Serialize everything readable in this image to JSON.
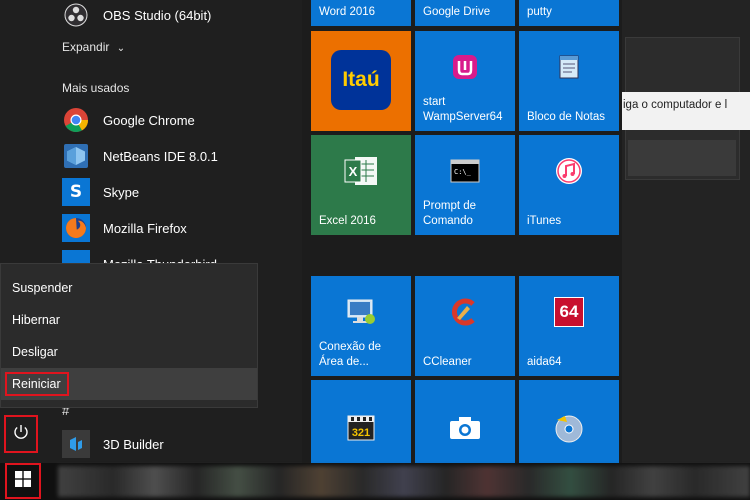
{
  "app_list": {
    "top_app": "OBS Studio (64bit)",
    "expand_label": "Expandir",
    "most_used_label": "Mais usados",
    "most_used": [
      "Google Chrome",
      "NetBeans IDE 8.0.1",
      "Skype",
      "Mozilla Firefox",
      "Mozilla Thunderbird"
    ],
    "hash_label": "#",
    "hash_apps": [
      "3D Builder"
    ]
  },
  "power_menu": {
    "items": [
      "Suspender",
      "Hibernar",
      "Desligar",
      "Reiniciar"
    ],
    "highlighted": "Reiniciar"
  },
  "tiles": {
    "top_row": [
      "Word 2016",
      "Google Drive",
      "putty"
    ],
    "row1": [
      {
        "label": "",
        "icon": "itau-logo",
        "icon_text": "Itaú",
        "color": "#ec7000"
      },
      {
        "label": "start WampServer64",
        "icon": "wamp-icon",
        "color": "#0a76d4"
      },
      {
        "label": "Bloco de Notas",
        "icon": "notepad-icon",
        "color": "#0a76d4"
      }
    ],
    "row2": [
      {
        "label": "Excel 2016",
        "icon": "excel-icon",
        "color": "#2d7a4a"
      },
      {
        "label": "Prompt de Comando",
        "icon": "cmd-icon",
        "color": "#0a76d4"
      },
      {
        "label": "iTunes",
        "icon": "itunes-icon",
        "color": "#0a76d4"
      }
    ],
    "row3": [
      {
        "label": "Conexão de Área de...",
        "icon": "remote-desktop-icon",
        "color": "#0a76d4"
      },
      {
        "label": "CCleaner",
        "icon": "ccleaner-icon",
        "color": "#0a76d4"
      },
      {
        "label": "aida64",
        "icon": "aida64-icon",
        "icon_text": "64",
        "color": "#0a76d4"
      }
    ],
    "row4": [
      {
        "label": "",
        "icon": "media-player-classic-icon",
        "color": "#0a76d4"
      },
      {
        "label": "",
        "icon": "camera-icon",
        "color": "#0a76d4"
      },
      {
        "label": "",
        "icon": "dvd-icon",
        "color": "#0a76d4"
      }
    ]
  },
  "background_window": {
    "tooltip_text": "iga o computador e l"
  },
  "icons": {
    "power": "power-icon",
    "start": "windows-logo-icon"
  },
  "colors": {
    "tile_blue": "#0a76d4",
    "highlight_red": "#e0141e"
  }
}
